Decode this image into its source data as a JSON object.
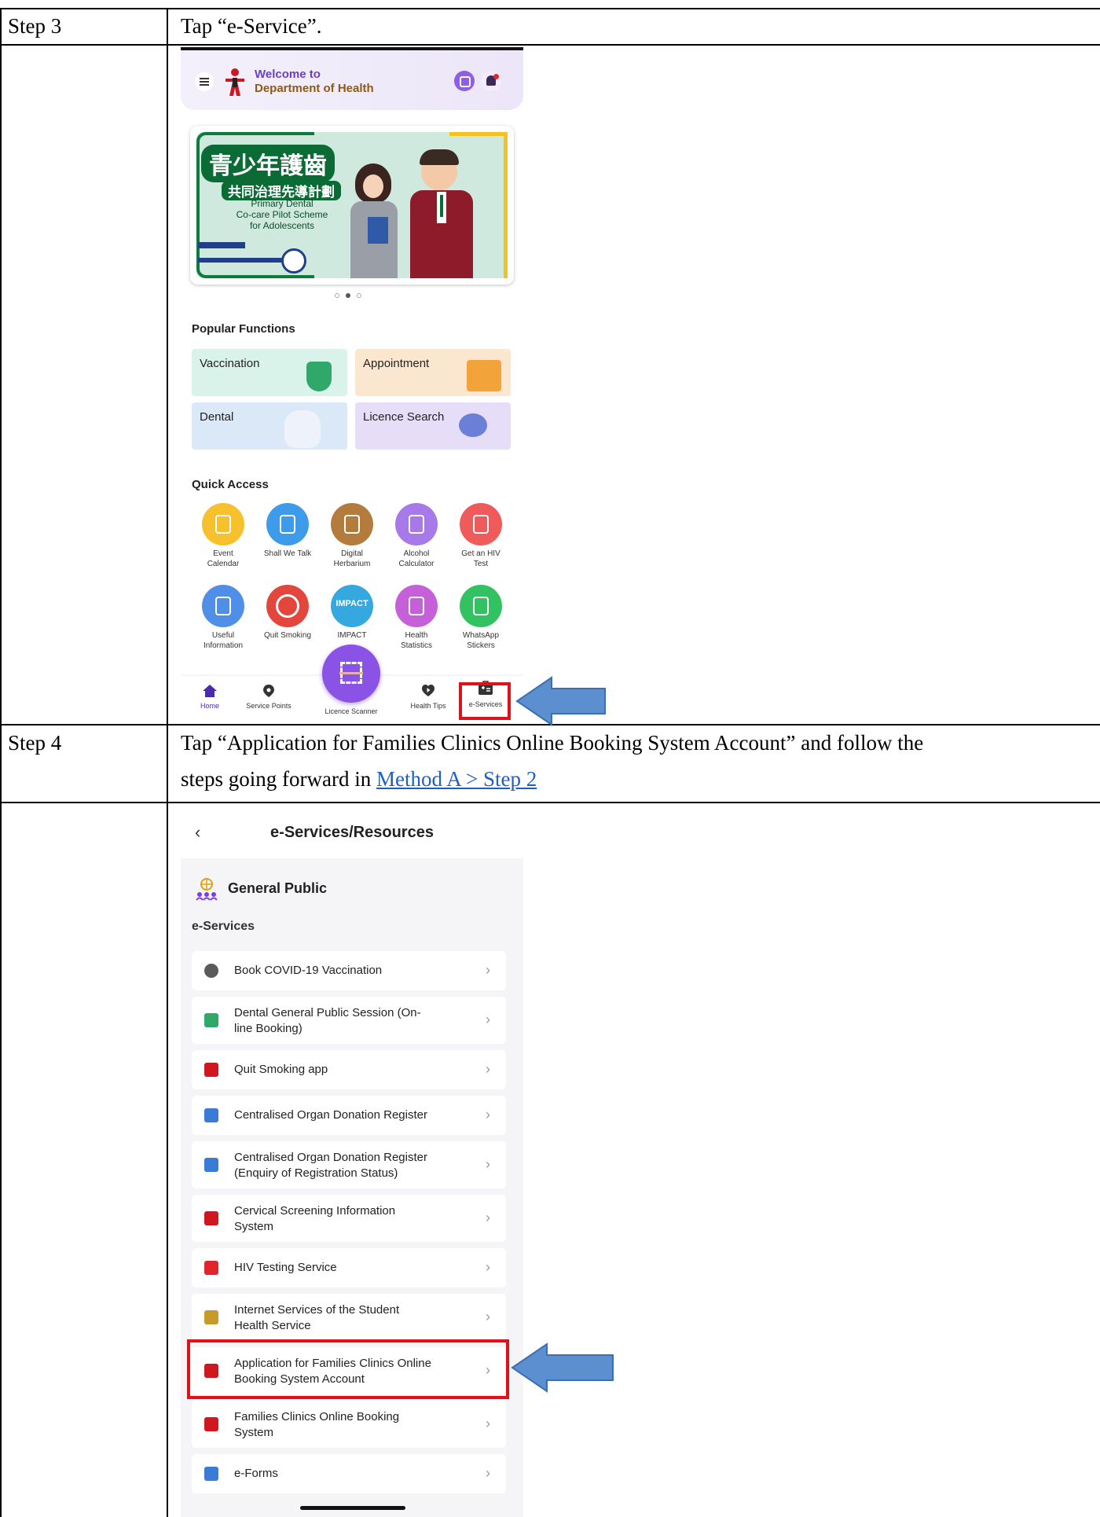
{
  "step3": {
    "label": "Step 3",
    "instruction": "Tap “e-Service”."
  },
  "step4": {
    "label": "Step 4",
    "instruction_line1": "Tap “Application for Families Clinics Online Booking System Account” and follow the",
    "instruction_line2": "steps going forward in ",
    "link": "Method A > Step 2"
  },
  "home_screen": {
    "welcome_line1": "Welcome to",
    "welcome_line2": "Department of Health",
    "banner": {
      "title_zh": "青少年護齒",
      "subtitle_zh": "共同治理先導計劃",
      "title_en_1": "Primary Dental",
      "title_en_2": "Co-care Pilot Scheme",
      "title_en_3": "for Adolescents"
    },
    "popular_title": "Popular Functions",
    "popular": [
      {
        "label": "Vaccination",
        "color": "#d9f2ea"
      },
      {
        "label": "Appointment",
        "color": "#fbe7cf"
      },
      {
        "label": "Dental",
        "color": "#dbe8f7"
      },
      {
        "label": "Licence Search",
        "color": "#e6def8"
      }
    ],
    "quick_title": "Quick Access",
    "quick_row1": [
      {
        "label1": "Event",
        "label2": "Calendar",
        "color": "#f6c12c",
        "icon": "calendar-icon"
      },
      {
        "label1": "Shall We Talk",
        "label2": "",
        "color": "#3d9be9",
        "icon": "talk-icon"
      },
      {
        "label1": "Digital",
        "label2": "Herbarium",
        "color": "#b47c3c",
        "icon": "herb-icon"
      },
      {
        "label1": "Alcohol",
        "label2": "Calculator",
        "color": "#a779e9",
        "icon": "glass-icon"
      },
      {
        "label1": "Get an HIV",
        "label2": "Test",
        "color": "#ef5b5b",
        "icon": "ribbon-icon"
      }
    ],
    "quick_row2": [
      {
        "label1": "Useful",
        "label2": "Information",
        "color": "#4f8fe8",
        "icon": "document-icon"
      },
      {
        "label1": "Quit Smoking",
        "label2": "",
        "color": "#e3463c",
        "icon": "no-smoking-icon"
      },
      {
        "label1": "IMPACT",
        "label2": "",
        "color": "#35a8e0",
        "icon": "impact-icon"
      },
      {
        "label1": "Health",
        "label2": "Statistics",
        "color": "#c660d9",
        "icon": "statistics-icon"
      },
      {
        "label1": "WhatsApp",
        "label2": "Stickers",
        "color": "#33c262",
        "icon": "whatsapp-icon"
      }
    ],
    "impact_text": "IMPACT",
    "nav": {
      "home": "Home",
      "service_points": "Service Points",
      "licence_scanner": "Licence Scanner",
      "health_tips": "Health Tips",
      "e_services": "e-Services"
    }
  },
  "eservices_screen": {
    "title": "e-Services/Resources",
    "section": "General Public",
    "subsection": "e-Services",
    "items": [
      {
        "line1": "Book COVID-19 Vaccination",
        "line2": "",
        "icon": "hp-icon"
      },
      {
        "line1": "Dental General Public Session (On-",
        "line2": "line Booking)",
        "icon": "dental-icon"
      },
      {
        "line1": "Quit Smoking app",
        "line2": "",
        "icon": "doh-icon"
      },
      {
        "line1": "Centralised Organ Donation Register",
        "line2": "",
        "icon": "organ-icon"
      },
      {
        "line1": "Centralised Organ Donation Register",
        "line2": "(Enquiry of Registration Status)",
        "icon": "organ-icon"
      },
      {
        "line1": "Cervical Screening Information",
        "line2": "System",
        "icon": "doh-icon"
      },
      {
        "line1": "HIV Testing Service",
        "line2": "",
        "icon": "hiv-icon"
      },
      {
        "line1": "Internet Services of the Student",
        "line2": "Health Service",
        "icon": "student-health-icon"
      },
      {
        "line1": "Application for Families Clinics Online",
        "line2": "Booking System Account",
        "icon": "doh-icon"
      },
      {
        "line1": "Families Clinics Online Booking",
        "line2": "System",
        "icon": "doh-icon"
      },
      {
        "line1": "e-Forms",
        "line2": "",
        "icon": "eforms-icon"
      }
    ]
  },
  "colors": {
    "highlight": "#e1111a",
    "arrow": "#5b8fcf",
    "accent_purple": "#7b3fe4"
  }
}
